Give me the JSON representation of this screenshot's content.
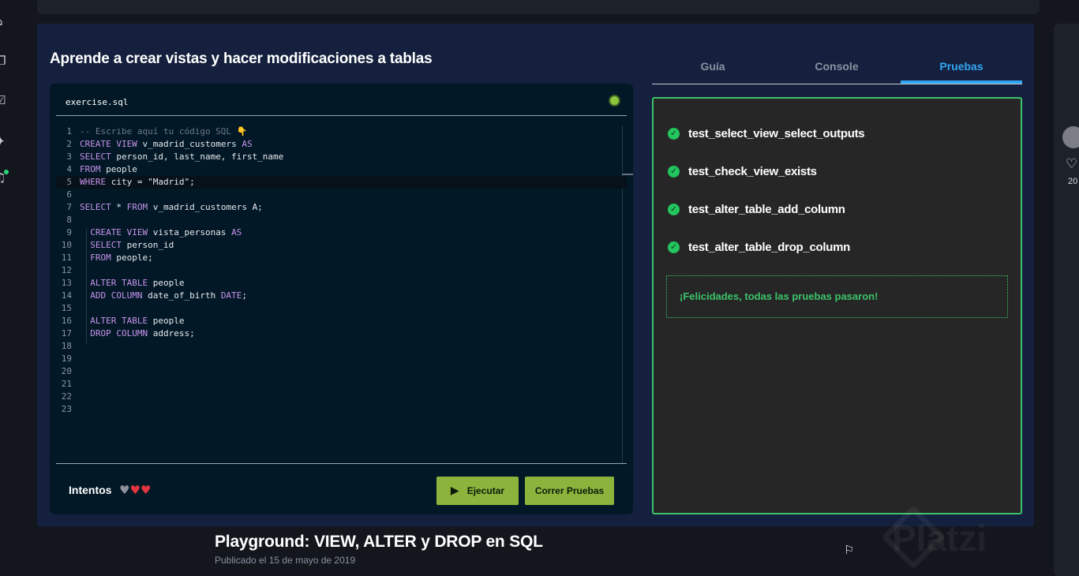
{
  "rail": {
    "icons": [
      "home-icon",
      "layers-icon",
      "checklist-icon",
      "sparkles-icon",
      "bell-icon"
    ]
  },
  "lesson": {
    "title": "Aprende a crear vistas y hacer modificaciones a tablas"
  },
  "editor": {
    "filename": "exercise.sql",
    "status_color": "#8cc63f",
    "lines": [
      [
        {
          "t": "-- Escribe aquí tu código SQL 👇",
          "c": "cm"
        }
      ],
      [
        {
          "t": "CREATE VIEW ",
          "c": "kw"
        },
        {
          "t": "v_madrid_customers ",
          "c": "id"
        },
        {
          "t": "AS",
          "c": "kw"
        }
      ],
      [
        {
          "t": "SELECT ",
          "c": "kw"
        },
        {
          "t": "person_id, last_name, first_name",
          "c": "id"
        }
      ],
      [
        {
          "t": "FROM ",
          "c": "kw"
        },
        {
          "t": "people",
          "c": "id"
        }
      ],
      [
        {
          "t": "WHERE ",
          "c": "kw"
        },
        {
          "t": "city = \"Madrid\";",
          "c": "id"
        }
      ],
      [],
      [
        {
          "t": "SELECT ",
          "c": "kw"
        },
        {
          "t": "* ",
          "c": "id"
        },
        {
          "t": "FROM ",
          "c": "kw"
        },
        {
          "t": "v_madrid_customers A;",
          "c": "id"
        }
      ],
      [],
      [
        {
          "t": "  CREATE VIEW ",
          "c": "kw"
        },
        {
          "t": "vista_personas ",
          "c": "id"
        },
        {
          "t": "AS",
          "c": "kw"
        }
      ],
      [
        {
          "t": "  SELECT ",
          "c": "kw"
        },
        {
          "t": "person_id",
          "c": "id"
        }
      ],
      [
        {
          "t": "  FROM ",
          "c": "kw"
        },
        {
          "t": "people;",
          "c": "id"
        }
      ],
      [],
      [
        {
          "t": "  ALTER TABLE ",
          "c": "kw"
        },
        {
          "t": "people",
          "c": "id"
        }
      ],
      [
        {
          "t": "  ADD COLUMN ",
          "c": "kw"
        },
        {
          "t": "date_of_birth ",
          "c": "id"
        },
        {
          "t": "DATE",
          "c": "kw"
        },
        {
          "t": ";",
          "c": "id"
        }
      ],
      [],
      [
        {
          "t": "  ALTER TABLE ",
          "c": "kw"
        },
        {
          "t": "people",
          "c": "id"
        }
      ],
      [
        {
          "t": "  DROP COLUMN ",
          "c": "kw"
        },
        {
          "t": "address;",
          "c": "id"
        }
      ],
      [],
      [],
      [],
      [],
      [],
      []
    ],
    "active_line": 5,
    "attempts_label": "Intentos",
    "hearts": [
      "grey",
      "red",
      "red"
    ],
    "run_label": "Ejecutar",
    "tests_label": "Correr Pruebas"
  },
  "tabs": [
    {
      "label": "Guía"
    },
    {
      "label": "Console"
    },
    {
      "label": "Pruebas"
    }
  ],
  "active_tab": 2,
  "results": {
    "tests": [
      "test_select_view_select_outputs",
      "test_check_view_exists",
      "test_alter_table_add_column",
      "test_alter_table_drop_column"
    ],
    "success_message": "¡Felicidades, todas las pruebas pasaron!",
    "success_color": "#3cc36a"
  },
  "footer": {
    "title": "Playground: VIEW, ALTER y DROP en SQL",
    "published": "Publicado el 15 de mayo de 2019",
    "watermark": "Platzi"
  },
  "side": {
    "count": "20"
  }
}
